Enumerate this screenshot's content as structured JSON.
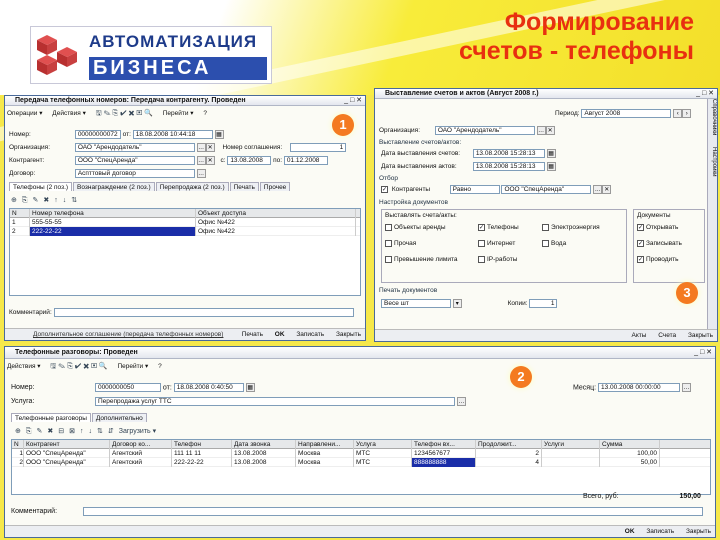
{
  "slide": {
    "title_line1": "Формирование",
    "title_line2": "счетов - телефоны"
  },
  "logo": {
    "line1": "АВТОМАТИЗАЦИЯ",
    "line2": "БИЗНЕСА"
  },
  "badges": {
    "b1": "1",
    "b2": "2",
    "b3": "3"
  },
  "colors": {
    "accent": "#e83010",
    "badge": "#f47a20",
    "selection": "#1a2da8"
  },
  "w1": {
    "title": "Передача телефонных номеров: Передача контрагенту. Проведен",
    "menu": [
      "Операции ▾",
      "Действия ▾",
      "Перейти ▾",
      "?"
    ],
    "nomer_label": "Номер:",
    "nomer": "00000000072",
    "ot_label": "от:",
    "ot": "18.08.2008 10:44:18",
    "org_label": "Организация:",
    "org": "ОАО \"Арендодатель\"",
    "nomsogl_label": "Номер соглашения:",
    "nomsogl": "1",
    "kontr_label": "Контрагент:",
    "kontr": "ООО \"СпецАренда\"",
    "s_label": "с:",
    "s": "13.08.2008",
    "po_label": "по:",
    "po": "01.12.2008",
    "dog_label": "Договор:",
    "dog": "Аспттовый договор",
    "tabs": [
      "Телефоны (2 поз.)",
      "Вознаграждение (2 поз.)",
      "Перепродажа (2 поз.)",
      "Печать",
      "Прочее"
    ],
    "grid_headers": [
      "N",
      "Номер телефона",
      "Объект доступа"
    ],
    "rows": [
      [
        "1",
        "555-55-55",
        "Офис №422"
      ],
      [
        "2",
        "222-22-22",
        "Офис №422"
      ]
    ],
    "comment_label": "Комментарий:",
    "footer_left": "Дополнительное соглашение (передача телефонных номеров)",
    "footer_buttons": [
      "Печать",
      "OK",
      "Записать",
      "Закрыть"
    ]
  },
  "w2": {
    "title": "Телефонные разговоры: Проведен",
    "menu": [
      "Действия ▾",
      "Перейти ▾",
      "?"
    ],
    "nomer_label": "Номер:",
    "nomer": "0000000050",
    "ot_label": "от:",
    "ot": "18.08.2008 0:40:50",
    "mes_label": "Месяц:",
    "mes": "13.00.2008 00:00:00",
    "usl_label": "Услуга:",
    "usl": "Перепродажа услуг ТТС",
    "tabs": [
      "Телефонные разговоры",
      "Дополнительно"
    ],
    "load_label": "Загрузить ▾",
    "grid_headers": [
      "N",
      "Контрагент",
      "Договор ко...",
      "Телефон",
      "Дата звонка",
      "Направлени...",
      "Услуга",
      "Телефон вх...",
      "Продолжит...",
      "Услуги",
      "Сумма"
    ],
    "rows": [
      [
        "1",
        "ООО \"СпецАренда\"",
        "Агентский",
        "111 11 11",
        "13.08.2008",
        "Москва",
        "МТС",
        "1234567677",
        "2",
        "",
        "100,00"
      ],
      [
        "2",
        "ООО \"СпецАренда\"",
        "Агентский",
        "222-22-22",
        "13.08.2008",
        "Москва",
        "МТС",
        "888888888",
        "4",
        "",
        "50,00"
      ]
    ],
    "total_label": "Всего, руб:",
    "total": "150,00",
    "comment_label": "Комментарий:",
    "footer_buttons": [
      "OK",
      "Записать",
      "Закрыть"
    ]
  },
  "w3": {
    "title": "Выставление счетов и актов (Август 2008 г.)",
    "side_tabs": [
      "Справочники",
      "Настройки"
    ],
    "period_label": "Период:",
    "period": "Август 2008",
    "org_label": "Организация:",
    "org": "ОАО \"Арендодатель\"",
    "vys_label": "Выставление счетов/актов:",
    "date1_label": "Дата выставления счетов:",
    "date1": "13.08.2008 15:28:13",
    "date2_label": "Дата выставления актов:",
    "date2": "13.08.2008 15:28:13",
    "otbor_label": "Отбор",
    "kontr_label": "Контрагенты",
    "kontr_cond": "Равно",
    "kontr": "ООО \"СпецАренда\"",
    "nastr_label": "Настройка документов",
    "vsch_label": "Выставлять счета/акты:",
    "checks": [
      "Объекты аренды",
      "Телефоны",
      "Электроэнергия",
      "Прочая",
      "Интернет",
      "Вода",
      "Превышение лимита",
      "IP-работы"
    ],
    "docs_label": "Документы",
    "docs": [
      "Открывать",
      "Записывать",
      "Проводить"
    ],
    "print_label": "Печать документов",
    "print_value": "Весе шт",
    "copies_label": "Копии:",
    "copies": "1",
    "footer_buttons": [
      "Акты",
      "Счета",
      "Закрыть"
    ]
  }
}
